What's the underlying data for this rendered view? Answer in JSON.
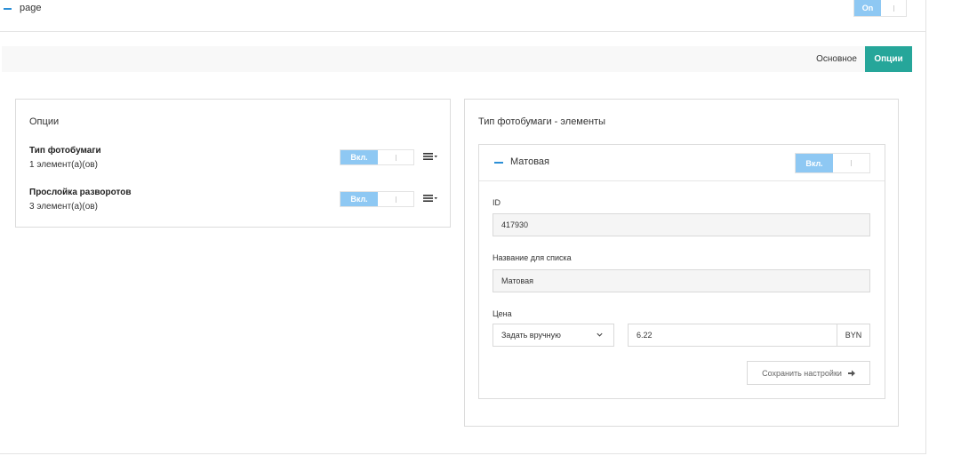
{
  "page_row": {
    "label": "page",
    "toggle_on_label": "On"
  },
  "tabs": {
    "main_label": "Основное",
    "options_label": "Опции",
    "active": "options",
    "active_color": "#26a69a"
  },
  "options_panel": {
    "title": "Опции",
    "toggle_on_label": "Вкл.",
    "items": [
      {
        "name": "Тип фотобумаги",
        "count": "1 элемент(а)(ов)"
      },
      {
        "name": "Прослойка разворотов",
        "count": "3 элемент(а)(ов)"
      }
    ]
  },
  "elements_panel": {
    "title": "Тип фотобумаги - элементы",
    "element": {
      "name": "Матовая",
      "toggle_on_label": "Вкл.",
      "id_label": "ID",
      "id_value": "417930",
      "list_name_label": "Название для списка",
      "list_name_value": "Матовая",
      "price_label": "Цена",
      "price_mode": "Задать вручную",
      "price_value": "6.22",
      "currency": "BYN",
      "save_label": "Сохранить настройки"
    }
  },
  "colors": {
    "toggle_on": "#8ec8f3",
    "accent_blue": "#2c8fd6",
    "border": "#dcdcdc"
  },
  "icons": {
    "collapse": "minus-icon",
    "menu": "list-menu-icon",
    "dropdown": "chevron-down-icon",
    "save": "arrow-right-icon"
  }
}
